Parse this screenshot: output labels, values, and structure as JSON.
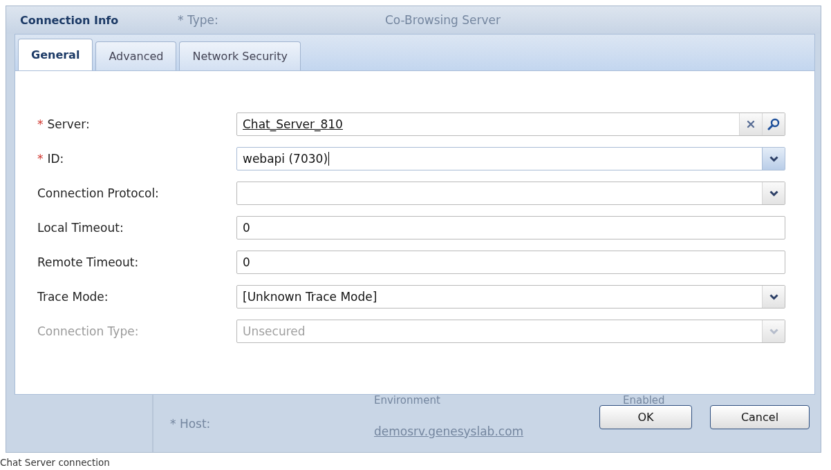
{
  "dialog": {
    "title": "Connection Info"
  },
  "background": {
    "type_label": "* Type:",
    "type_value": "Co-Browsing Server",
    "column_1": "Environment",
    "column_2": "Enabled",
    "host_label": "* Host:",
    "host_value": "demosrv.genesyslab.com"
  },
  "tabs": [
    {
      "label": "General",
      "selected": true
    },
    {
      "label": "Advanced",
      "selected": false
    },
    {
      "label": "Network Security",
      "selected": false
    }
  ],
  "fields": [
    {
      "kind": "lookup",
      "mark": "*",
      "label": "Server:",
      "value": "Chat_Server_810",
      "disabled": false,
      "focused": false
    },
    {
      "kind": "combo",
      "mark": "*",
      "label": "ID:",
      "value": "webapi (7030)",
      "disabled": false,
      "focused": true
    },
    {
      "kind": "combo",
      "label": "Connection Protocol:",
      "disabled": false,
      "focused": false
    },
    {
      "kind": "text",
      "label": "Local Timeout:",
      "value": "0",
      "disabled": false,
      "focused": false
    },
    {
      "kind": "text",
      "label": "Remote Timeout:",
      "value": "0",
      "disabled": false,
      "focused": false
    },
    {
      "kind": "combo",
      "label": "Trace Mode:",
      "value": "[Unknown Trace Mode]",
      "disabled": false,
      "focused": false
    },
    {
      "kind": "combo",
      "label": "Connection Type:",
      "value": "Unsecured",
      "disabled": true,
      "focused": false
    }
  ],
  "buttons": [
    "OK",
    "Cancel"
  ],
  "caption": "Chat Server connection"
}
